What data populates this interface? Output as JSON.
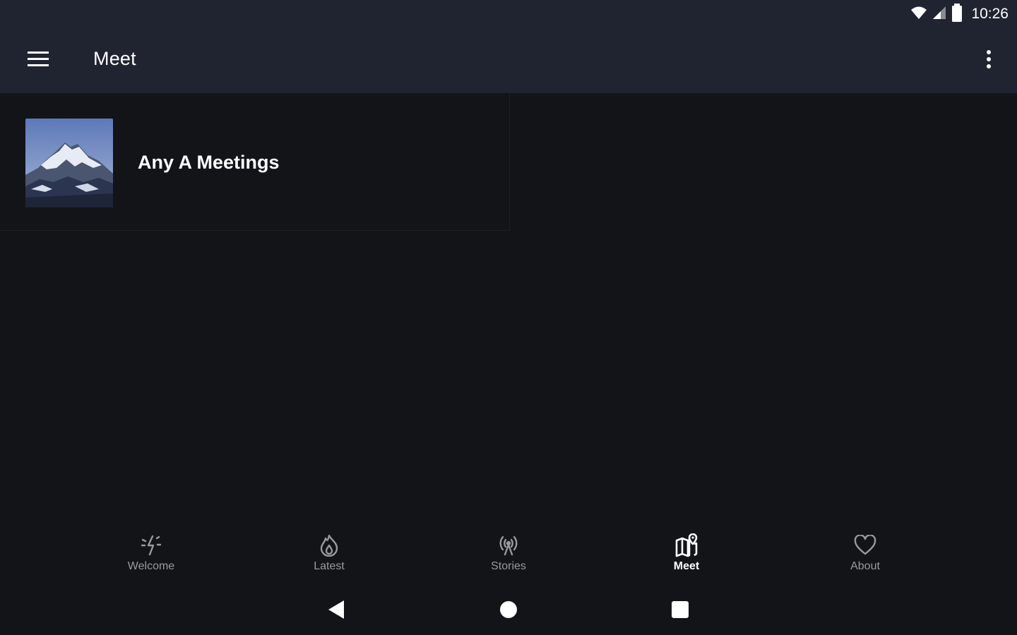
{
  "status_bar": {
    "time": "10:26",
    "icons": [
      "wifi-icon",
      "signal-icon",
      "battery-icon"
    ]
  },
  "app_bar": {
    "title": "Meet",
    "menu_icon": "menu-icon",
    "overflow_icon": "more-vert-icon"
  },
  "content": {
    "items": [
      {
        "title": "Any A Meetings",
        "thumbnail": "mountain-photo"
      }
    ]
  },
  "bottom_nav": {
    "items": [
      {
        "label": "Welcome",
        "icon": "sparkle-icon",
        "active": false
      },
      {
        "label": "Latest",
        "icon": "flame-icon",
        "active": false
      },
      {
        "label": "Stories",
        "icon": "broadcast-icon",
        "active": false
      },
      {
        "label": "Meet",
        "icon": "map-pin-icon",
        "active": true
      },
      {
        "label": "About",
        "icon": "heart-icon",
        "active": false
      }
    ]
  },
  "system_nav": {
    "buttons": [
      "back-icon",
      "home-icon",
      "recents-icon"
    ]
  },
  "colors": {
    "background": "#131418",
    "app_bar": "#202430",
    "active_label": "#ffffff",
    "inactive_label": "#9a9a9a"
  }
}
